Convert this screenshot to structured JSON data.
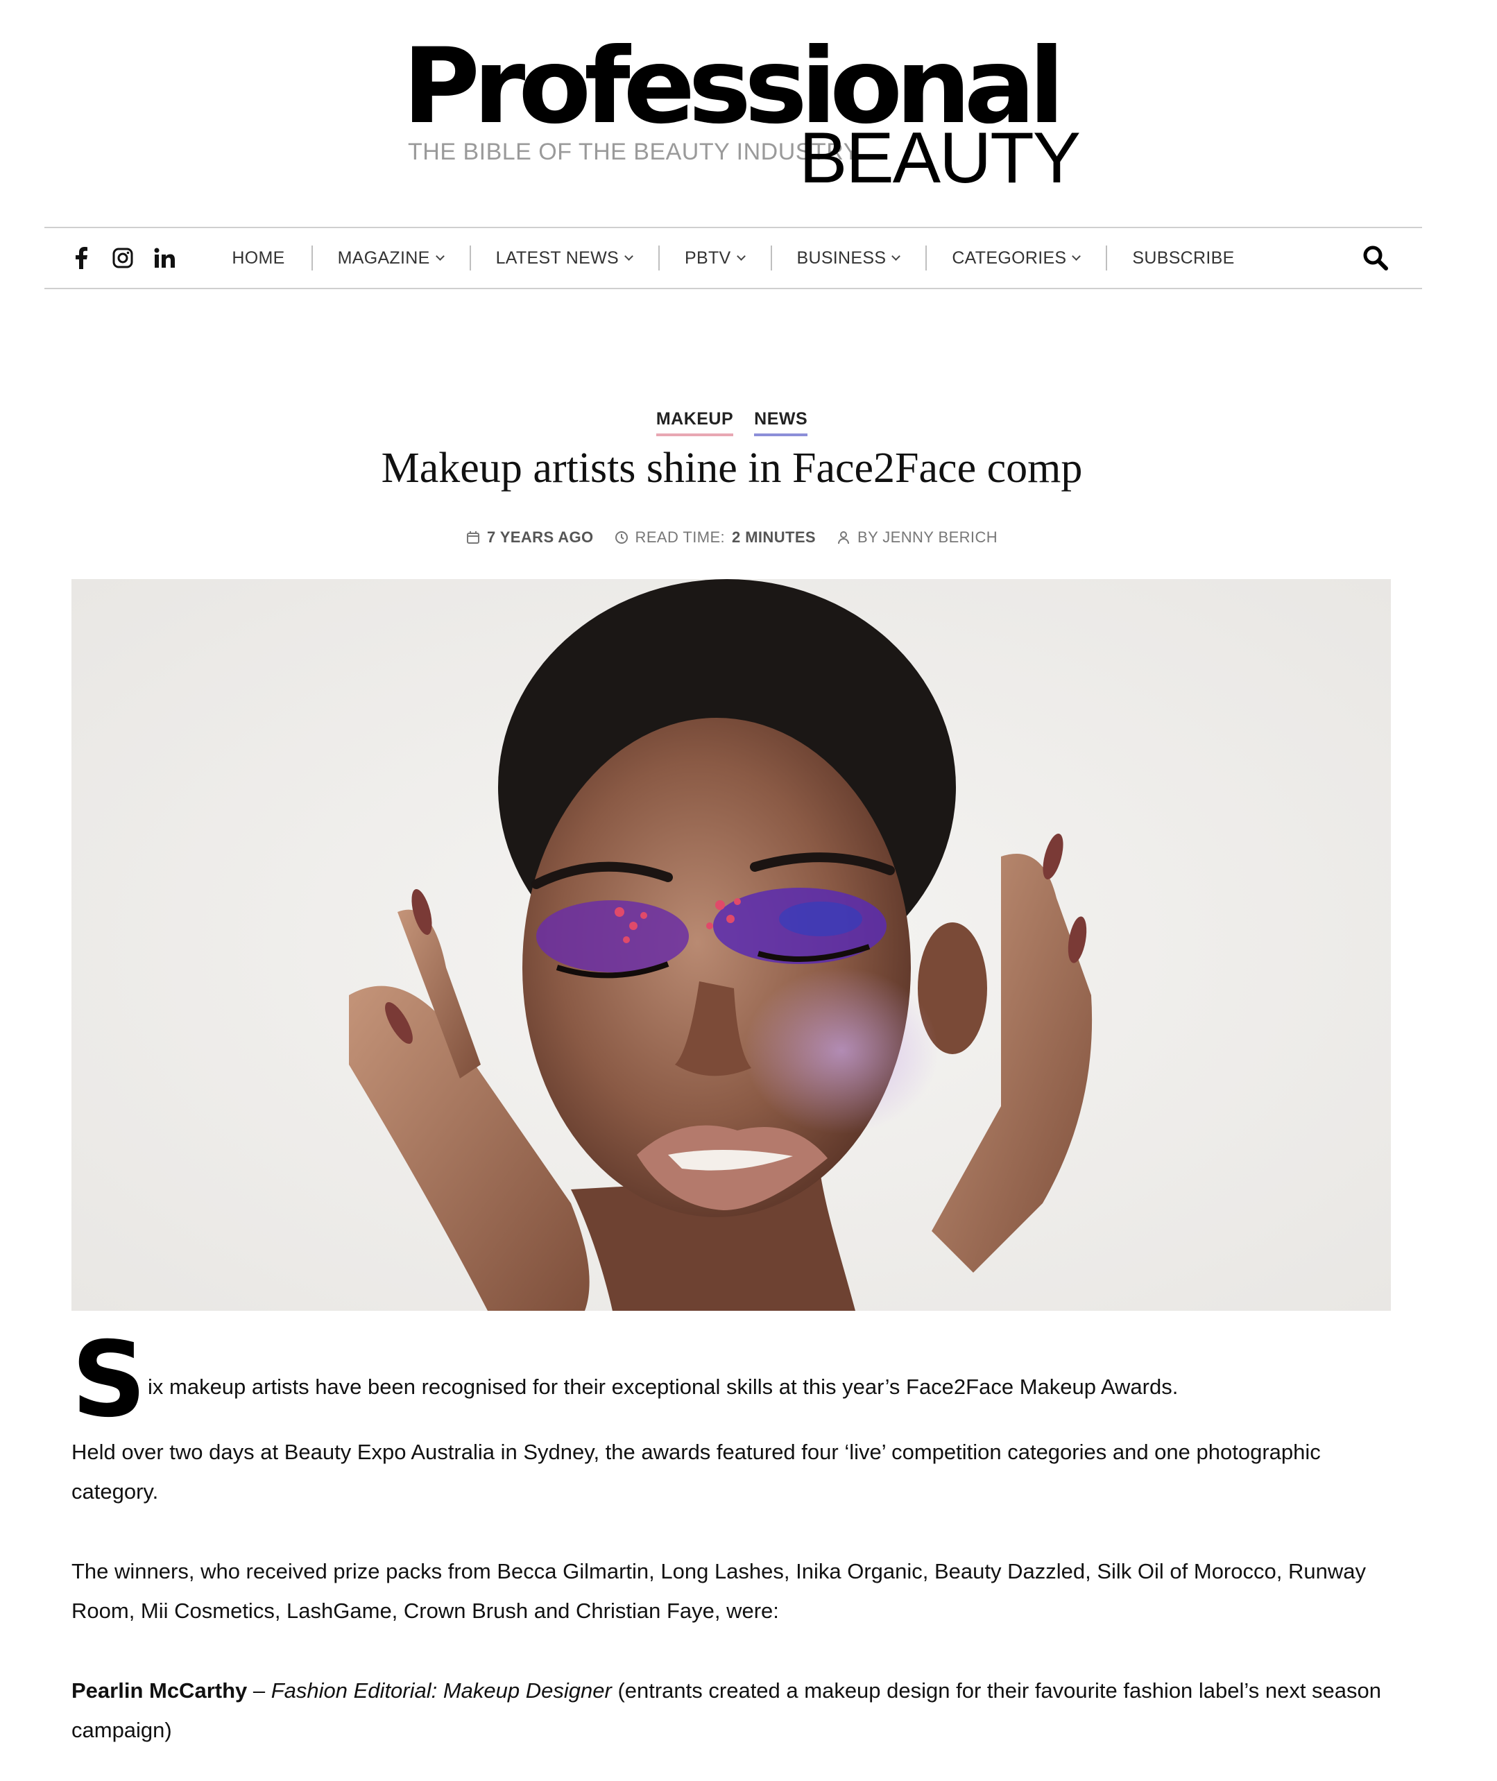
{
  "logo": {
    "main": "Professional",
    "tagline": "THE BIBLE OF THE BEAUTY INDUSTRY",
    "sub": "BEAUTY"
  },
  "nav": {
    "social": [
      "facebook-icon",
      "instagram-icon",
      "linkedin-icon"
    ],
    "items": [
      {
        "label": "HOME",
        "dropdown": false
      },
      {
        "label": "MAGAZINE",
        "dropdown": true
      },
      {
        "label": "LATEST NEWS",
        "dropdown": true
      },
      {
        "label": "PBTV",
        "dropdown": true
      },
      {
        "label": "BUSINESS",
        "dropdown": true
      },
      {
        "label": "CATEGORIES",
        "dropdown": true
      },
      {
        "label": "SUBSCRIBE",
        "dropdown": false
      }
    ],
    "search_icon": "search-icon"
  },
  "article": {
    "categories": [
      "MAKEUP",
      "NEWS"
    ],
    "category_colors": {
      "MAKEUP": "#e8a7b3",
      "NEWS": "#8c8fd8"
    },
    "title": "Makeup artists shine in Face2Face comp",
    "meta": {
      "date": "7 YEARS AGO",
      "read_time_label": "READ TIME:",
      "read_time_value": "2 MINUTES",
      "author": "BY JENNY BERICH"
    },
    "dropcap": "S",
    "first_line": "ix makeup artists have been recognised for their exceptional skills at this year’s Face2Face Makeup Awards.",
    "paragraph_2": "Held over two days at Beauty Expo Australia in Sydney, the awards featured four ‘live’ competition categories and one photographic category.",
    "paragraph_3": "The winners, who received prize packs from Becca Gilmartin, Long Lashes, Inika Organic, Beauty Dazzled, Silk Oil of Morocco, Runway Room, Mii Cosmetics, LashGame, Crown Brush and Christian Faye, were:",
    "winner_1": {
      "name": "Pearlin McCarthy",
      "dash": " – ",
      "category": "Fashion Editorial: Makeup Designer",
      "note": " (entrants created a makeup design for their favourite fashion label’s next season campaign)"
    }
  }
}
